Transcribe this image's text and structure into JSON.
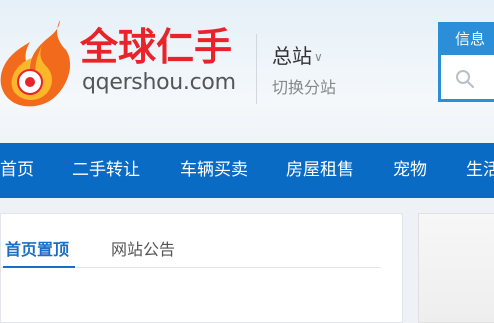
{
  "header": {
    "logo_cn": "全球仁手",
    "logo_url": "qqershou.com",
    "city_current": "总站",
    "city_switch": "切换分站"
  },
  "search": {
    "tab_label": "信息"
  },
  "nav": {
    "items": [
      {
        "label": "首页"
      },
      {
        "label": "二手转让"
      },
      {
        "label": "车辆买卖"
      },
      {
        "label": "房屋租售"
      },
      {
        "label": "宠物"
      },
      {
        "label": "生活"
      }
    ]
  },
  "tabs": {
    "items": [
      {
        "label": "首页置顶"
      },
      {
        "label": "网站公告"
      }
    ]
  },
  "colors": {
    "nav_bg": "#0a6bc5",
    "accent": "#1a6fc4",
    "logo_red": "#e8232a",
    "flame_orange": "#f26a1b"
  }
}
